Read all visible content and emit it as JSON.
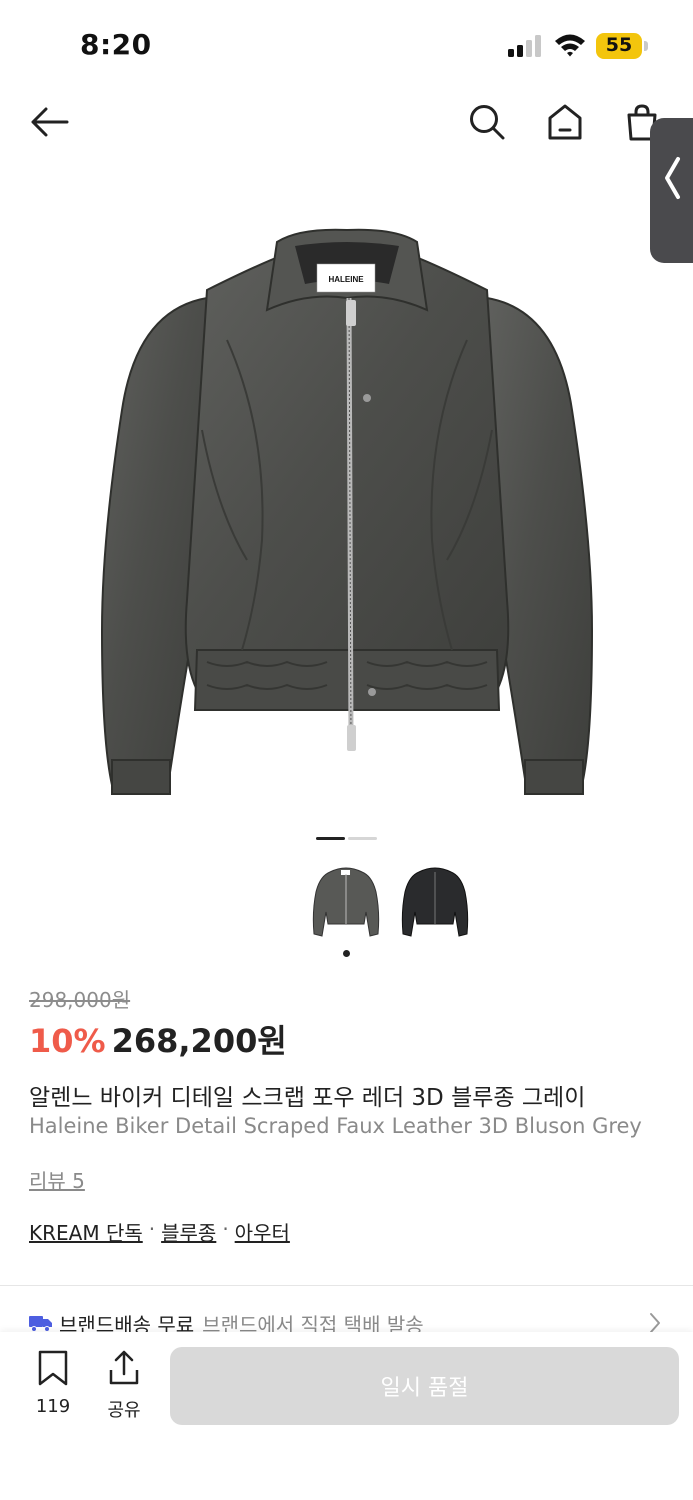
{
  "status_bar": {
    "time": "8:20",
    "battery": "55"
  },
  "product": {
    "brand_tag": "HALEINE",
    "original_price": "298,000원",
    "discount": "10%",
    "sale_price": "268,200원",
    "title_ko": "알렌느 바이커 디테일 스크랩 포우 레더 3D 블루종 그레이",
    "title_en": "Haleine Biker Detail Scraped Faux Leather 3D Bluson Grey",
    "review_label": "리뷰 5",
    "tags": [
      "KREAM 단독",
      "블루종",
      "아우터"
    ],
    "tag_separator": "·",
    "image_count": 2,
    "current_image_index": 0
  },
  "delivery": {
    "title": "브랜드배송 무료",
    "description": "브랜드에서 직접 택배 발송"
  },
  "bottom_bar": {
    "bookmark_count": "119",
    "share_label": "공유",
    "cta_label": "일시 품절"
  },
  "colors": {
    "accent_discount": "#ef5b4a",
    "cta_disabled": "#d9d9d9"
  }
}
